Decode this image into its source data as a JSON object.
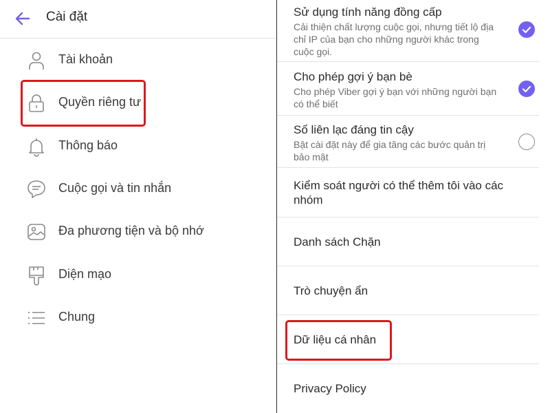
{
  "header": {
    "title": "Cài đặt",
    "back_icon": "arrow-left-icon",
    "accent": "#7360f2"
  },
  "sidebar": {
    "items": [
      {
        "label": "Tài khoản",
        "icon": "user-icon"
      },
      {
        "label": "Quyền riêng tư",
        "icon": "lock-icon"
      },
      {
        "label": "Thông báo",
        "icon": "bell-icon"
      },
      {
        "label": "Cuộc gọi và tin nhắn",
        "icon": "chat-icon"
      },
      {
        "label": "Đa phương tiện và bộ nhớ",
        "icon": "image-icon"
      },
      {
        "label": "Diện mạo",
        "icon": "paintbrush-icon"
      },
      {
        "label": "Chung",
        "icon": "list-icon"
      }
    ]
  },
  "privacy": {
    "settings": [
      {
        "title": "Sử dụng tính năng đồng cấp",
        "description": "Cải thiện chất lượng cuộc gọi, nhưng tiết lộ địa chỉ IP của bạn cho những người khác trong cuộc gọi.",
        "checked": true
      },
      {
        "title": "Cho phép gợi ý bạn bè",
        "description": "Cho phép Viber gợi ý bạn với những người bạn có thể biết",
        "checked": true
      },
      {
        "title": "Số liên lạc đáng tin cậy",
        "description": "Bật cài đặt này để gia tăng các bước quản trị bảo mật",
        "checked": false
      }
    ],
    "links": [
      {
        "label": "Kiểm soát người có thể thêm tôi vào các nhóm"
      },
      {
        "label": "Danh sách Chặn"
      },
      {
        "label": "Trò chuyện ẩn"
      },
      {
        "label": "Dữ liệu cá nhân"
      },
      {
        "label": "Privacy Policy"
      }
    ]
  },
  "highlight_color": "#e0161c"
}
